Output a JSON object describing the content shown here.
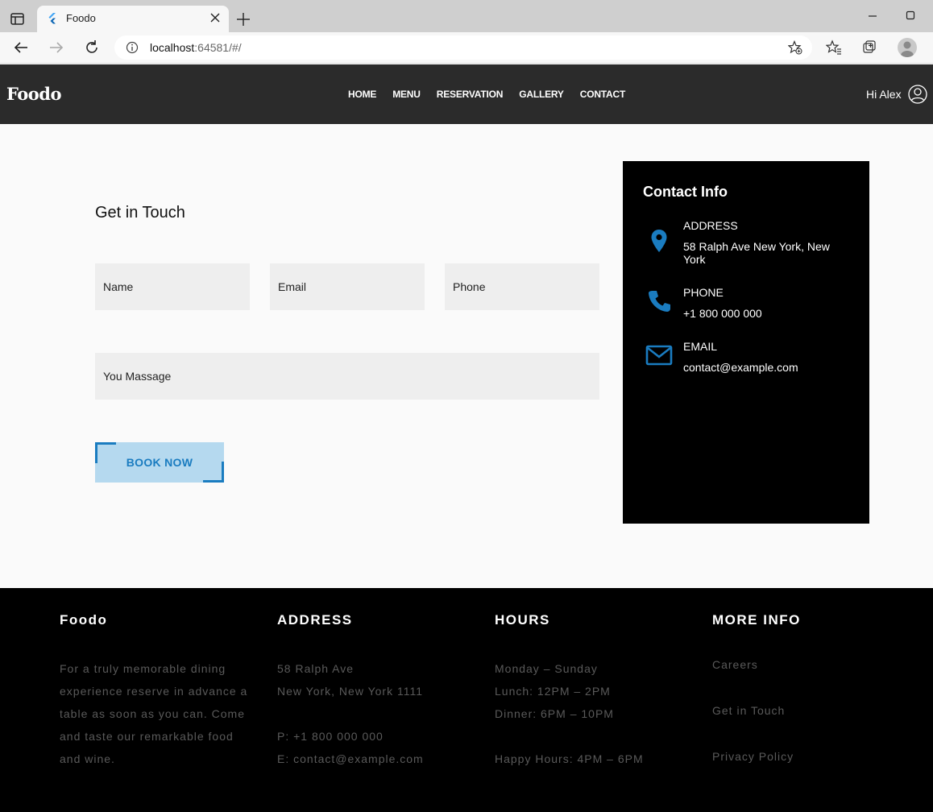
{
  "browser": {
    "tab_title": "Foodo",
    "url_host": "localhost",
    "url_rest": ":64581/#/"
  },
  "header": {
    "logo": "Foodo",
    "nav": [
      "HOME",
      "MENU",
      "RESERVATION",
      "GALLERY",
      "CONTACT"
    ],
    "greeting": "Hi Alex"
  },
  "contact_form": {
    "title": "Get in Touch",
    "name_placeholder": "Name",
    "email_placeholder": "Email",
    "phone_placeholder": "Phone",
    "message_placeholder": "You Massage",
    "submit_label": "BOOK NOW"
  },
  "contact_info": {
    "title": "Contact Info",
    "address_label": "ADDRESS",
    "address_value": "58 Ralph Ave New York, New York",
    "phone_label": "PHONE",
    "phone_value": "+1 800 000 000",
    "email_label": "EMAIL",
    "email_value": "contact@example.com",
    "accent_color": "#1a7cc0"
  },
  "footer": {
    "about_title": "Foodo",
    "about_text": "For a truly memorable dining experience reserve in advance a table as soon as you can. Come and taste our remarkable food and wine.",
    "address_title": "ADDRESS",
    "address_line1": "58 Ralph Ave",
    "address_line2": "New York, New York 1111",
    "phone": "P: +1 800 000 000",
    "email": "E: contact@example.com",
    "hours_title": "HOURS",
    "hours_days": "Monday – Sunday",
    "hours_lunch": "Lunch: 12PM – 2PM",
    "hours_dinner": "Dinner: 6PM – 10PM",
    "hours_happy": "Happy Hours: 4PM – 6PM",
    "more_title": "MORE INFO",
    "links": [
      "Careers",
      "Get in Touch",
      "Privacy Policy"
    ]
  }
}
